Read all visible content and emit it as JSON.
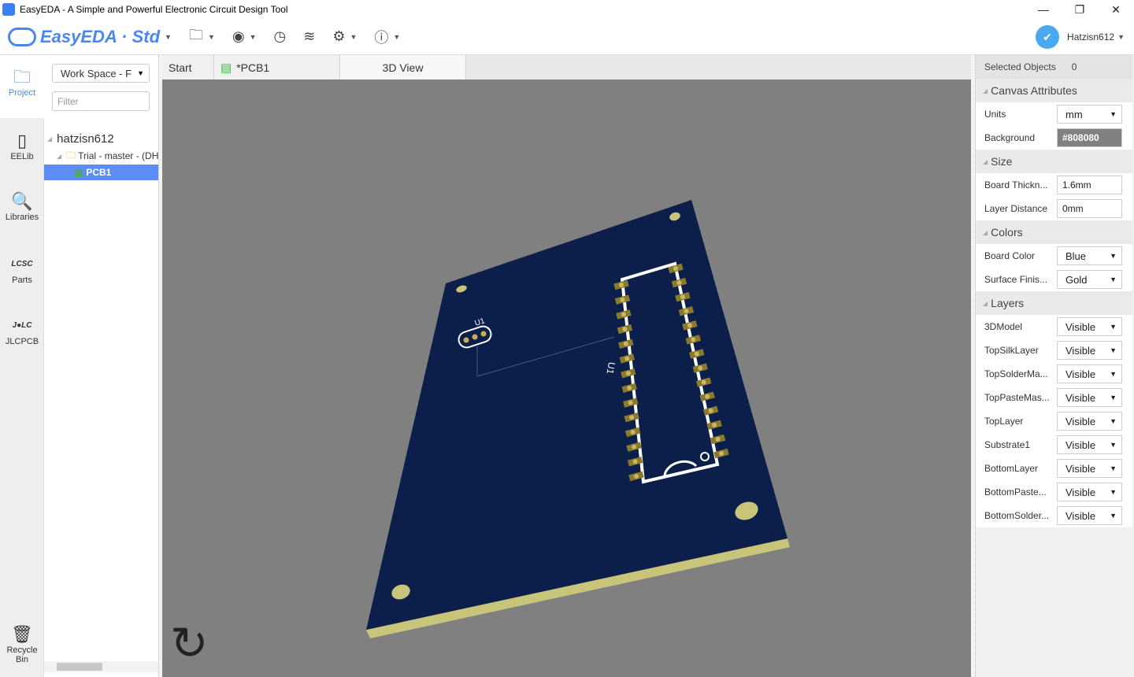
{
  "window": {
    "title": "EasyEDA - A Simple and Powerful Electronic Circuit Design Tool",
    "minimize": "—",
    "restore": "❐",
    "close": "✕"
  },
  "toolbar": {
    "logo": "EasyEDA · Std",
    "icons": [
      "folder-icon",
      "eye-icon",
      "history-icon",
      "layers-icon",
      "gear-icon",
      "help-icon"
    ],
    "user": "Hatzisn612"
  },
  "nav": [
    {
      "label": "Project",
      "icon": "folder-icon"
    },
    {
      "label": "EELib",
      "icon": "chip-icon"
    },
    {
      "label": "Libraries",
      "icon": "search-chip-icon"
    },
    {
      "label": "Parts",
      "icon": "lcsc-icon"
    },
    {
      "label": "JLCPCB",
      "icon": "jlc-icon"
    },
    {
      "label": "Recycle Bin",
      "icon": "trash-icon"
    }
  ],
  "panel": {
    "workspace": "Work Space - F",
    "filter_placeholder": "Filter",
    "tree": {
      "user": "hatzisn612",
      "project": "Trial - master - (DH",
      "file": "PCB1"
    }
  },
  "tabs": [
    {
      "label": "Start"
    },
    {
      "label": "*PCB1"
    },
    {
      "label": "3D View"
    }
  ],
  "canvas": {
    "component_label": "U1",
    "chip_label": "U1",
    "board_color": "#0b1f4a",
    "edge_color": "#c8c47a",
    "background": "#808080"
  },
  "props": {
    "selected_label": "Selected Objects",
    "selected_count": "0",
    "canvas_attributes": "Canvas Attributes",
    "units_label": "Units",
    "units": "mm",
    "background_label": "Background",
    "background": "#808080",
    "size": "Size",
    "thickness_label": "Board Thickn...",
    "thickness": "1.6mm",
    "distance_label": "Layer Distance",
    "distance": "0mm",
    "colors": "Colors",
    "board_color_label": "Board Color",
    "board_color": "Blue",
    "finish_label": "Surface Finis...",
    "finish": "Gold",
    "layers_title": "Layers",
    "layers": [
      {
        "name": "3DModel",
        "value": "Visible"
      },
      {
        "name": "TopSilkLayer",
        "value": "Visible"
      },
      {
        "name": "TopSolderMa...",
        "value": "Visible"
      },
      {
        "name": "TopPasteMas...",
        "value": "Visible"
      },
      {
        "name": "TopLayer",
        "value": "Visible"
      },
      {
        "name": "Substrate1",
        "value": "Visible"
      },
      {
        "name": "BottomLayer",
        "value": "Visible"
      },
      {
        "name": "BottomPaste...",
        "value": "Visible"
      },
      {
        "name": "BottomSolder...",
        "value": "Visible"
      }
    ]
  }
}
